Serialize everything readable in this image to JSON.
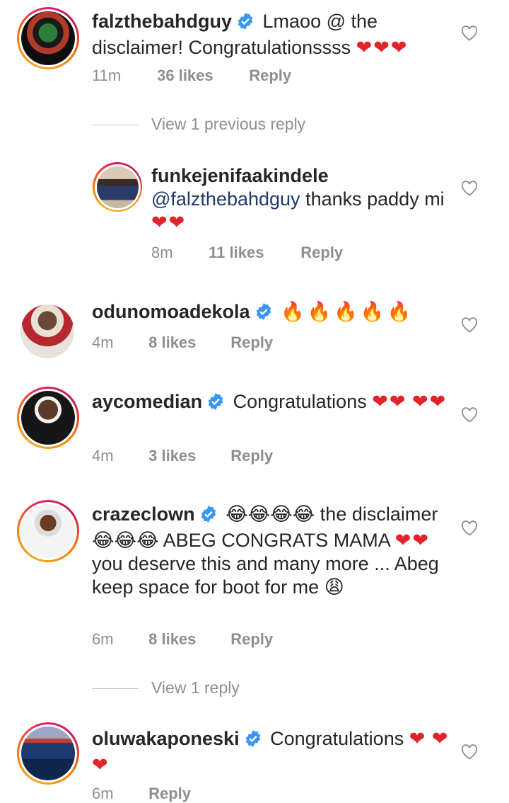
{
  "comments": [
    {
      "username": "falzthebahdguy",
      "verified": true,
      "text": "Lmaoo @ the disclaimer! Congratulationssss",
      "emoji": "❤❤❤",
      "time": "11m",
      "likes": "36 likes",
      "reply": "Reply"
    },
    {
      "username": "funkejenifaakindele",
      "verified": false,
      "mention": "@falzthebahdguy",
      "text": "thanks paddy mi",
      "emoji": "❤❤",
      "time": "8m",
      "likes": "11 likes",
      "reply": "Reply"
    },
    {
      "username": "odunomoadekola",
      "verified": true,
      "emoji": "🔥🔥🔥🔥🔥",
      "time": "4m",
      "likes": "8 likes",
      "reply": "Reply"
    },
    {
      "username": "aycomedian",
      "verified": true,
      "text": "Congratulations",
      "emoji": "❤❤",
      "emoji2": "❤❤",
      "time": "4m",
      "likes": "3 likes",
      "reply": "Reply"
    },
    {
      "username": "crazeclown",
      "verified": true,
      "emoji": "😂😂😂😂",
      "text": "the disclaimer",
      "emoji2": "😂😂😂",
      "text2": "ABEG CONGRATS MAMA",
      "emoji3": "❤❤",
      "text3": "you deserve this and many more ... Abeg keep space for boot for me",
      "emoji4": "😩",
      "time": "6m",
      "likes": "8 likes",
      "reply": "Reply"
    },
    {
      "username": "oluwakaponeski",
      "verified": true,
      "text": "Congratulations",
      "emoji": "❤",
      "emoji2": "❤❤",
      "time": "6m",
      "reply": "Reply"
    }
  ],
  "view_previous_reply": "View 1 previous reply",
  "view_reply": "View 1 reply",
  "colors": {
    "verified": "#3897f0",
    "heart": "#e0242b",
    "meta": "#8e8e8e",
    "mention": "#1e3a6e"
  },
  "icons": {
    "verified": "verified-badge-icon",
    "like": "heart-outline-icon"
  }
}
